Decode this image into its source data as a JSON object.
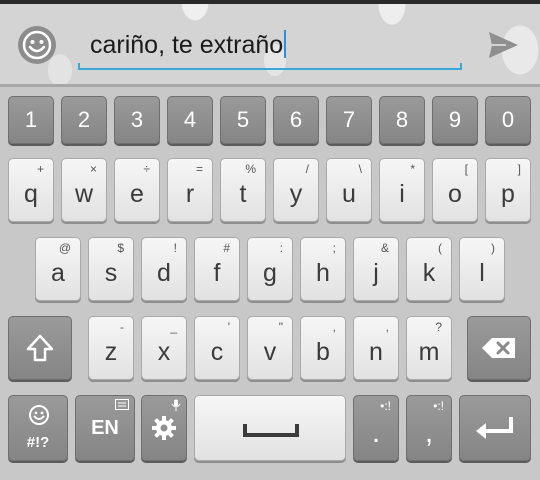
{
  "compose": {
    "text": "cariño, te extraño",
    "emoji_icon": "smiley-face-icon",
    "send_icon": "send-arrow-icon"
  },
  "keyboard": {
    "number_row": [
      "1",
      "2",
      "3",
      "4",
      "5",
      "6",
      "7",
      "8",
      "9",
      "0"
    ],
    "row1": [
      {
        "key": "q",
        "hint": "+"
      },
      {
        "key": "w",
        "hint": "×"
      },
      {
        "key": "e",
        "hint": "÷"
      },
      {
        "key": "r",
        "hint": "="
      },
      {
        "key": "t",
        "hint": "%"
      },
      {
        "key": "y",
        "hint": "/"
      },
      {
        "key": "u",
        "hint": "\\"
      },
      {
        "key": "i",
        "hint": "*"
      },
      {
        "key": "o",
        "hint": "["
      },
      {
        "key": "p",
        "hint": "]"
      }
    ],
    "row2": [
      {
        "key": "a",
        "hint": "@"
      },
      {
        "key": "s",
        "hint": "$"
      },
      {
        "key": "d",
        "hint": "!"
      },
      {
        "key": "f",
        "hint": "#"
      },
      {
        "key": "g",
        "hint": ":"
      },
      {
        "key": "h",
        "hint": ";"
      },
      {
        "key": "j",
        "hint": "&"
      },
      {
        "key": "k",
        "hint": "("
      },
      {
        "key": "l",
        "hint": ")"
      }
    ],
    "row3": [
      {
        "key": "z",
        "hint": "-"
      },
      {
        "key": "x",
        "hint": "_"
      },
      {
        "key": "c",
        "hint": "'"
      },
      {
        "key": "v",
        "hint": "\""
      },
      {
        "key": "b",
        "hint": ","
      },
      {
        "key": "n",
        "hint": ","
      },
      {
        "key": "m",
        "hint": "?"
      }
    ],
    "symbols_label": "#!?",
    "language_label": "EN",
    "period_label": ".",
    "comma_label": ",",
    "period_hint": "•:!",
    "comma_hint": "•:!",
    "icons": {
      "shift": "shift-arrow-icon",
      "backspace": "backspace-icon",
      "emoji": "smiley-face-icon",
      "settings": "gear-icon",
      "space": "space-bar-icon",
      "enter": "enter-return-icon"
    }
  }
}
